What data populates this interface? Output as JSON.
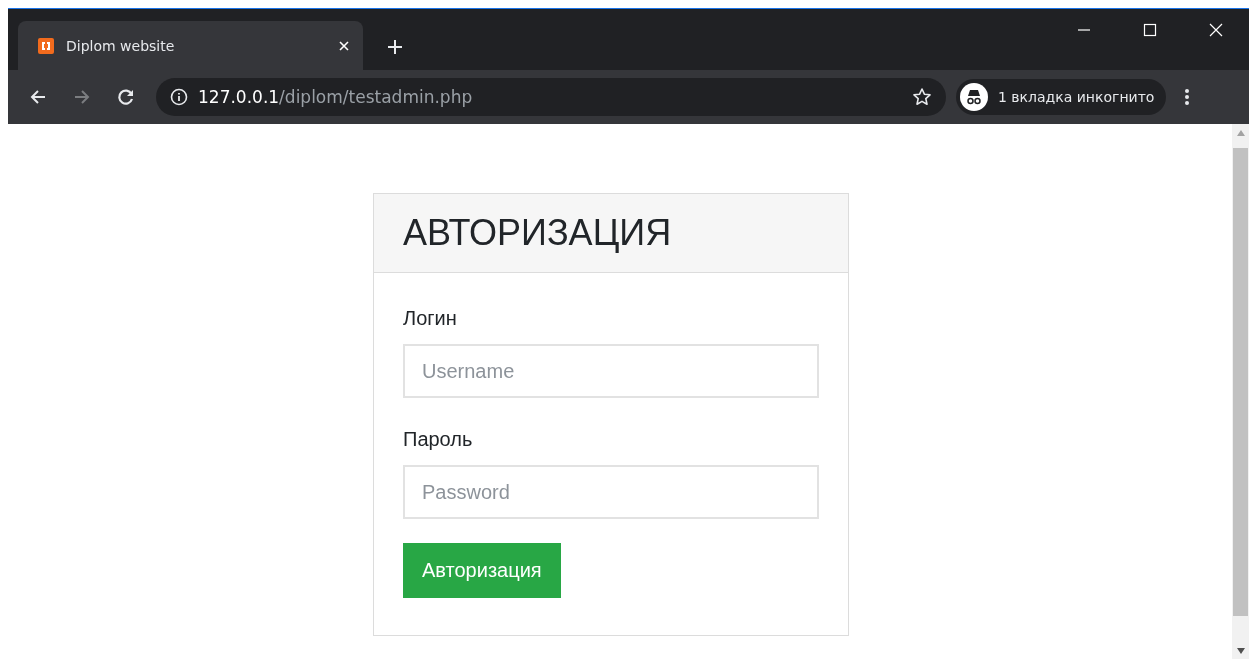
{
  "browser": {
    "tab": {
      "title": "Diplom website",
      "selected": true
    },
    "address": {
      "host": "127.0.0.1",
      "path": "/diplom/testadmin.php"
    },
    "forward_disabled": true,
    "incognito": "1 вкладка инкогнито"
  },
  "login_card": {
    "title": "АВТОРИЗАЦИЯ",
    "fields": [
      {
        "label": "Логин",
        "placeholder": "Username"
      },
      {
        "label": "Пароль",
        "placeholder": "Password"
      }
    ],
    "button": "Авторизация"
  }
}
